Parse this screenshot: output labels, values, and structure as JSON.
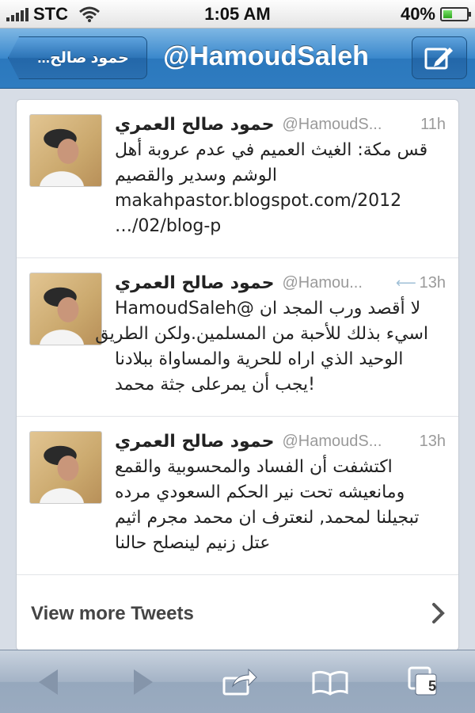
{
  "status_bar": {
    "carrier": "STC",
    "time": "1:05 AM",
    "battery_percent": "40%",
    "battery_level": 0.4
  },
  "nav": {
    "back_label": "حمود صالح...",
    "title": "@HamoudSaleh"
  },
  "tweets": [
    {
      "name": "حمود صالح العمري",
      "handle": "@HamoudS...",
      "time": "11h",
      "retweeted": false,
      "lines": [
        "قس مكة: الغيث العميم في عدم عروبة أهل",
        "الوشم وسدير والقصيم",
        "makahpastor.blogspot.com/2012",
        "…/02/blog-p"
      ]
    },
    {
      "name": "حمود صالح العمري",
      "handle": "@Hamou...",
      "time": "13h",
      "retweeted": true,
      "lines": [
        "لا أقصد ورب المجد ان @HamoudSaleh",
        "اسيء بذلك للأحبة من المسلمين.ولكن الطريق",
        "الوحيد الذي اراه للحرية والمساواة ببلادنا",
        "!يجب أن يمرعلى جثة محمد"
      ]
    },
    {
      "name": "حمود صالح العمري",
      "handle": "@HamoudS...",
      "time": "13h",
      "retweeted": false,
      "lines": [
        "اكتشفت أن الفساد والمحسوبية والقمع",
        "ومانعيشه تحت نير الحكم السعودي مرده",
        "تبجيلنا لمحمد, لنعترف ان محمد مجرم اثيم",
        "عتل زنيم لينصلح حالنا"
      ]
    }
  ],
  "view_more_label": "View more Tweets",
  "toolbar": {
    "tabs_count": "5"
  },
  "colors": {
    "nav_blue": "#2f7cc0",
    "card_bg": "#ffffff",
    "toolbar": "#9aabc0"
  }
}
